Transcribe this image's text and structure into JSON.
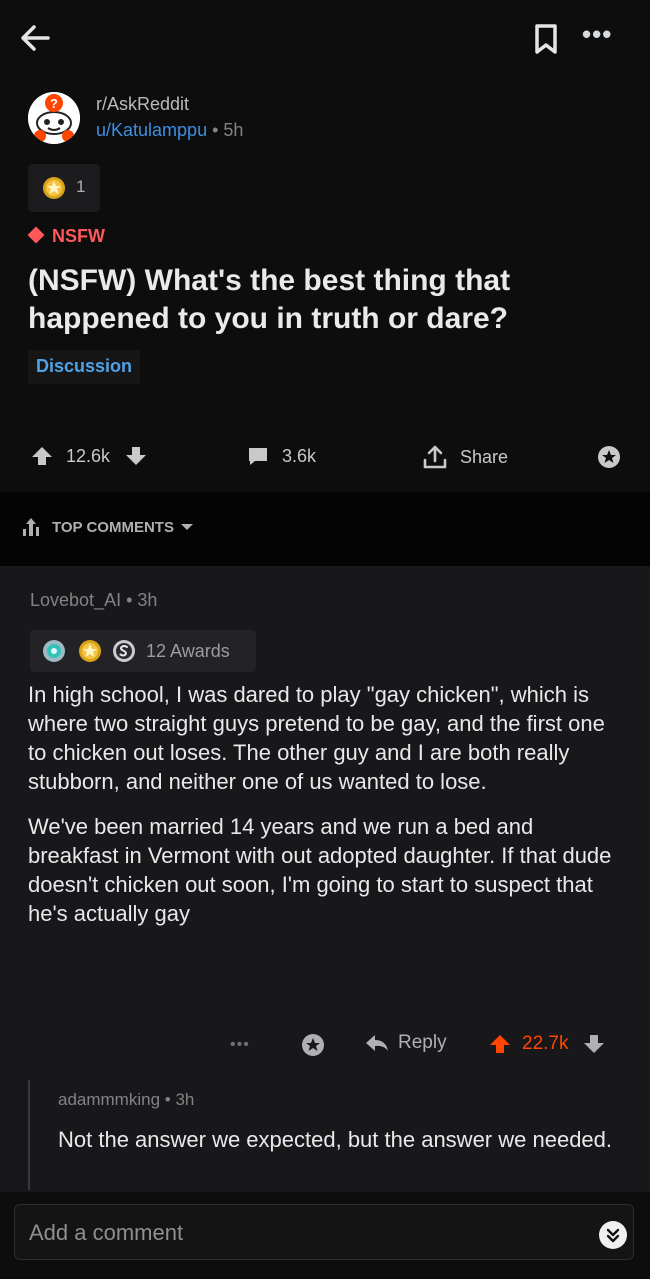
{
  "header": {
    "back_icon": "arrow-left-icon",
    "save_icon": "bookmark-icon",
    "more_label": "•••"
  },
  "post": {
    "subreddit": "r/AskReddit",
    "author": "u/Katulamppu",
    "age": "5h",
    "separator": " • ",
    "award_count": "1",
    "nsfw_label": "NSFW",
    "title": "(NSFW) What's the best thing that happened to you in truth or dare?",
    "flair": "Discussion",
    "votes": "12.6k",
    "comments": "3.6k",
    "share_label": "Share"
  },
  "sort": {
    "label": "TOP COMMENTS"
  },
  "comment": {
    "author": "Lovebot_AI",
    "age": "3h",
    "awards_label": "12 Awards",
    "paragraphs": [
      "In high school, I was dared to play \"gay chicken\", which is where two straight guys pretend to be gay, and the first one to chicken out loses. The other guy and I are both really stubborn, and neither one of us wanted to lose.",
      "We've been married 14 years and we run a bed and breakfast in Vermont with out adopted daughter. If that dude doesn't chicken out soon, I'm going to start to suspect that he's actually gay"
    ],
    "more_label": "•••",
    "reply_label": "Reply",
    "votes": "22.7k",
    "upvote_color": "#ff4500"
  },
  "reply": {
    "author": "adammmking",
    "age": "3h",
    "body": "Not the answer we expected, but the answer we needed."
  },
  "composer": {
    "placeholder": "Add a comment"
  },
  "colors": {
    "background": "#0d0d0e",
    "link_blue": "#3d8ee0",
    "nsfw_red": "#ff585b",
    "upvote_orange": "#ff4500"
  }
}
